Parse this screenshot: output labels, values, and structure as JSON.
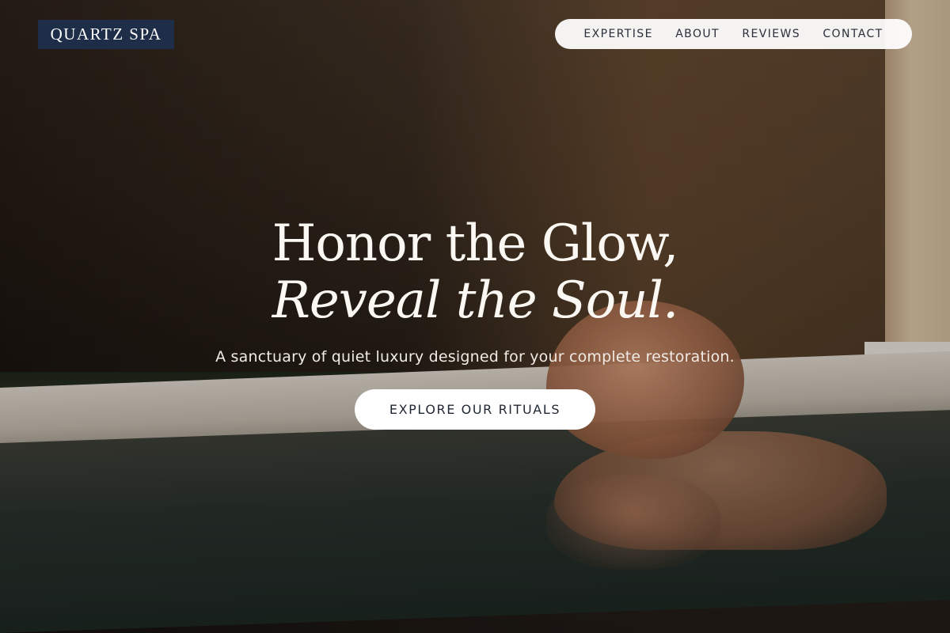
{
  "brand": {
    "name": "QUARTZ SPA",
    "bg_color": "#1e2d48"
  },
  "nav": {
    "items": [
      {
        "label": "EXPERTISE"
      },
      {
        "label": "ABOUT"
      },
      {
        "label": "REVIEWS"
      },
      {
        "label": "CONTACT"
      }
    ]
  },
  "hero": {
    "title_line1": "Honor the Glow,",
    "title_line2": "Reveal the Soul.",
    "subtitle": "A sanctuary of quiet luxury designed for your complete restoration.",
    "cta_label": "EXPLORE OUR RITUALS",
    "text_color": "#fbf8f3",
    "cta_text_color": "#1f2633"
  }
}
